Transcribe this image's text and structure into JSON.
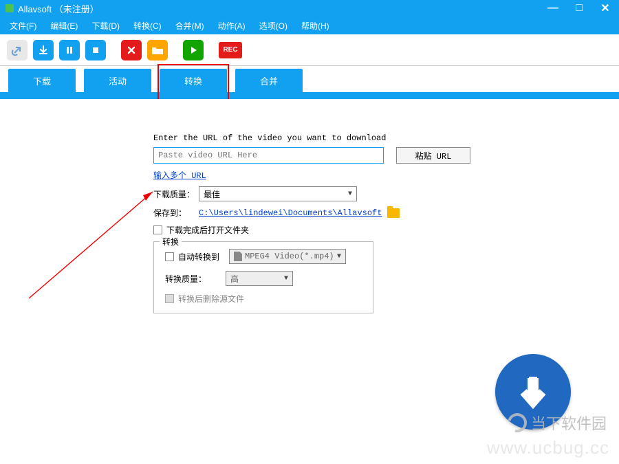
{
  "title": "Allavsoft （未注册）",
  "menu": {
    "file": "文件(F)",
    "edit": "编辑(E)",
    "download": "下载(D)",
    "convert": "转换(C)",
    "merge": "合并(M)",
    "action": "动作(A)",
    "options": "选项(O)",
    "help": "帮助(H)"
  },
  "toolbar": {
    "rec": "REC"
  },
  "tabs": {
    "download": "下载",
    "activity": "活动",
    "convert": "转换",
    "merge": "合并"
  },
  "form": {
    "prompt": "Enter the URL of the video you want to download",
    "url_placeholder": "Paste video URL Here",
    "paste_btn": "粘贴 URL",
    "multi_url": "输入多个 URL",
    "quality_label": "下载质量：",
    "quality_value": "最佳",
    "saveto_label": "保存到：",
    "saveto_path": "C:\\Users\\lindewei\\Documents\\Allavsoft",
    "open_after": "下载完成后打开文件夹",
    "group": {
      "legend": "转换",
      "auto_label": "自动转换到",
      "format_value": "MPEG4 Video(*.mp4)",
      "convq_label": "转换质量：",
      "convq_value": "高",
      "delete_src": "转换后删除源文件"
    }
  },
  "watermark": {
    "text1": "当下软件园",
    "text2": "www.ucbug.cc"
  }
}
